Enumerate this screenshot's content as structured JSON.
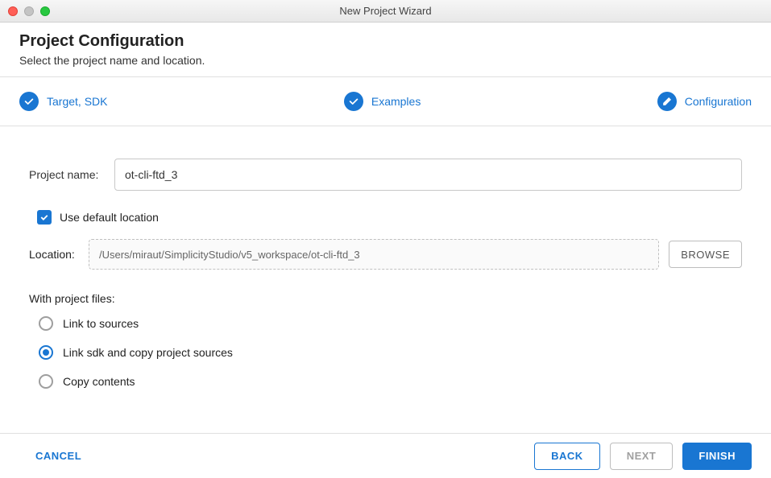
{
  "window": {
    "title": "New Project Wizard"
  },
  "header": {
    "title": "Project Configuration",
    "subtitle": "Select the project name and location."
  },
  "stepper": {
    "step1": "Target, SDK",
    "step2": "Examples",
    "step3": "Configuration"
  },
  "form": {
    "project_name_label": "Project name:",
    "project_name_value": "ot-cli-ftd_3",
    "use_default_location_label": "Use default location",
    "use_default_location_checked": true,
    "location_label": "Location:",
    "location_value": "/Users/miraut/SimplicityStudio/v5_workspace/ot-cli-ftd_3",
    "browse_label": "BROWSE",
    "with_project_files_label": "With project files:",
    "radio_options": {
      "link_to_sources": "Link to sources",
      "link_sdk_copy": "Link sdk and copy project sources",
      "copy_contents": "Copy contents"
    },
    "radio_selected": "link_sdk_copy"
  },
  "footer": {
    "cancel": "CANCEL",
    "back": "BACK",
    "next": "NEXT",
    "finish": "FINISH"
  }
}
